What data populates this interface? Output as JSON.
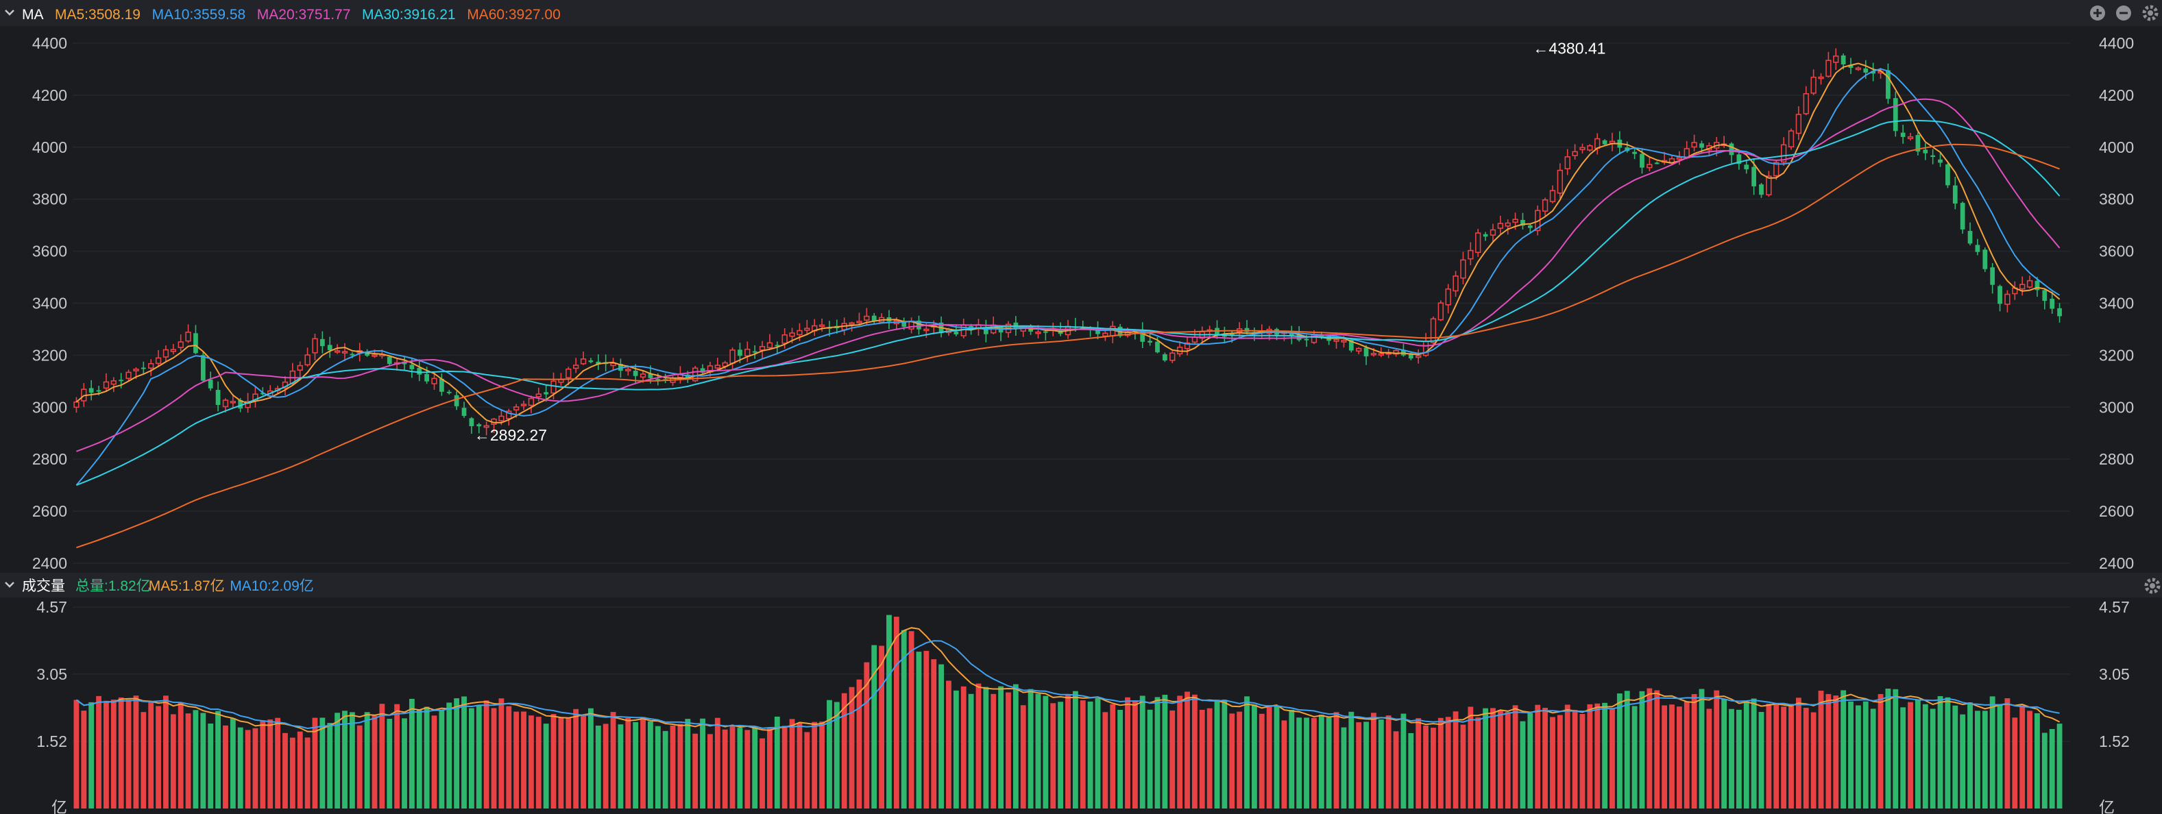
{
  "top_panel": {
    "label": "MA",
    "legend": [
      {
        "text": "MA5:3508.19",
        "color": "#f4a23c"
      },
      {
        "text": "MA10:3559.58",
        "color": "#3ea3f2"
      },
      {
        "text": "MA20:3751.77",
        "color": "#e24fc0"
      },
      {
        "text": "MA30:3916.21",
        "color": "#32d2e6"
      },
      {
        "text": "MA60:3927.00",
        "color": "#f06a2a"
      }
    ],
    "buttons": [
      "add-icon",
      "minus-icon",
      "gear-icon"
    ]
  },
  "volume_panel": {
    "label": "成交量",
    "legend": [
      {
        "text": "总量:1.82亿",
        "color": "#2ec37c"
      },
      {
        "text": "MA5:1.87亿",
        "color": "#f4a23c"
      },
      {
        "text": "MA10:2.09亿",
        "color": "#3ea3f2"
      }
    ],
    "buttons": [
      "gear-icon"
    ]
  },
  "colors": {
    "up": "#e84245",
    "down": "#2eb86e",
    "grid": "#26272c",
    "axis_text": "#c8c9cc",
    "panel_bar": "#23242a"
  },
  "chart_data": [
    {
      "type": "candlestick",
      "candle_count": 250,
      "ylim": [
        2400,
        4400
      ],
      "yticks": [
        "4400",
        "4200",
        "4000",
        "3800",
        "3600",
        "3400",
        "3200",
        "3000",
        "2800",
        "2600",
        "2400"
      ],
      "annotations": [
        {
          "text": "←4380.41",
          "index": 195,
          "value": 4380.41
        },
        {
          "text": "←2892.27",
          "index": 53,
          "value": 2892.27
        }
      ],
      "path_anchors": [
        [
          0,
          3040
        ],
        [
          10,
          3160
        ],
        [
          15,
          3280
        ],
        [
          17,
          3120
        ],
        [
          19,
          3010
        ],
        [
          22,
          3010
        ],
        [
          28,
          3080
        ],
        [
          32,
          3250
        ],
        [
          38,
          3200
        ],
        [
          43,
          3180
        ],
        [
          50,
          3060
        ],
        [
          53,
          2910
        ],
        [
          58,
          2990
        ],
        [
          63,
          3060
        ],
        [
          68,
          3180
        ],
        [
          75,
          3130
        ],
        [
          80,
          3100
        ],
        [
          88,
          3200
        ],
        [
          96,
          3270
        ],
        [
          105,
          3350
        ],
        [
          115,
          3300
        ],
        [
          128,
          3300
        ],
        [
          138,
          3300
        ],
        [
          143,
          3270
        ],
        [
          146,
          3160
        ],
        [
          150,
          3280
        ],
        [
          160,
          3290
        ],
        [
          170,
          3240
        ],
        [
          173,
          3210
        ],
        [
          176,
          3200
        ],
        [
          180,
          3200
        ],
        [
          183,
          3400
        ],
        [
          188,
          3660
        ],
        [
          192,
          3720
        ],
        [
          195,
          3700
        ],
        [
          200,
          3950
        ],
        [
          205,
          4030
        ],
        [
          210,
          3940
        ],
        [
          215,
          3980
        ],
        [
          220,
          4030
        ],
        [
          222,
          3980
        ],
        [
          226,
          3810
        ],
        [
          230,
          4080
        ],
        [
          233,
          4250
        ],
        [
          236,
          4350
        ],
        [
          239,
          4300
        ],
        [
          242,
          4300
        ],
        [
          244,
          4060
        ],
        [
          248,
          3980
        ],
        [
          250,
          3960
        ],
        [
          253,
          3700
        ],
        [
          256,
          3520
        ],
        [
          258,
          3400
        ],
        [
          262,
          3480
        ],
        [
          266,
          3350
        ]
      ],
      "series": [
        {
          "name": "MA5",
          "period": 5
        },
        {
          "name": "MA10",
          "period": 10
        },
        {
          "name": "MA20",
          "period": 20
        },
        {
          "name": "MA30",
          "period": 30
        },
        {
          "name": "MA60",
          "period": 60
        }
      ],
      "ma_starts": {
        "MA10": 2700,
        "MA20": 2830,
        "MA30": 2700,
        "MA60": 2460
      }
    },
    {
      "type": "bar",
      "ylim": [
        0,
        4.57
      ],
      "yticks": [
        "4.57",
        "3.05",
        "1.52",
        "亿"
      ],
      "unit": "亿",
      "volume_anchors": [
        [
          0,
          2.3
        ],
        [
          10,
          2.4
        ],
        [
          20,
          2.1
        ],
        [
          30,
          1.8
        ],
        [
          40,
          2.1
        ],
        [
          50,
          2.4
        ],
        [
          60,
          2.2
        ],
        [
          75,
          2.0
        ],
        [
          90,
          1.8
        ],
        [
          100,
          2.0
        ],
        [
          104,
          2.9
        ],
        [
          108,
          3.8
        ],
        [
          110,
          4.5
        ],
        [
          113,
          3.5
        ],
        [
          118,
          2.8
        ],
        [
          125,
          2.6
        ],
        [
          140,
          2.3
        ],
        [
          150,
          2.5
        ],
        [
          160,
          2.3
        ],
        [
          170,
          2.0
        ],
        [
          180,
          1.9
        ],
        [
          185,
          2.1
        ],
        [
          200,
          2.2
        ],
        [
          210,
          2.5
        ],
        [
          220,
          2.5
        ],
        [
          230,
          2.4
        ],
        [
          240,
          2.5
        ],
        [
          250,
          2.4
        ],
        [
          260,
          2.3
        ],
        [
          266,
          1.8
        ]
      ],
      "series": [
        {
          "name": "MA5",
          "period": 5
        },
        {
          "name": "MA10",
          "period": 10
        }
      ]
    }
  ]
}
